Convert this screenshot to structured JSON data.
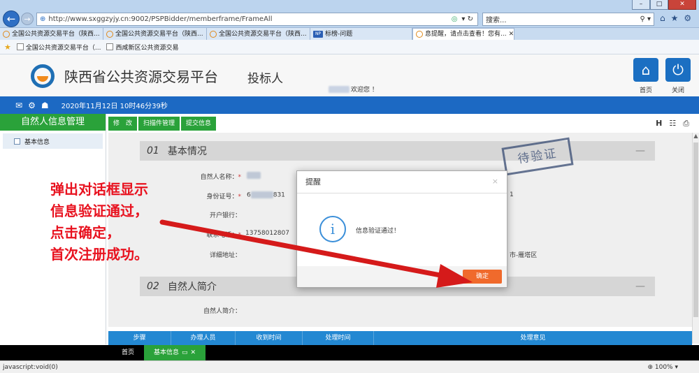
{
  "browser": {
    "url": "http://www.sxggzyjy.cn:9002/PSPBidder/memberframe/FrameAll",
    "search_placeholder": "搜索...",
    "window_controls": [
      "–",
      "□",
      "✕"
    ],
    "tabs": [
      {
        "label": "全国公共资源交易平台（陕西...",
        "active": false
      },
      {
        "label": "全国公共资源交易平台（陕西...",
        "active": false
      },
      {
        "label": "全国公共资源交易平台（陕西...",
        "active": false
      },
      {
        "label": "标榜-问题",
        "active": false
      },
      {
        "label": "息提醒，请点击查看！您有...",
        "active": true
      }
    ],
    "favorites": [
      "全国公共资源交易平台（...",
      "西咸新区公共资源交易"
    ],
    "status_text": "javascript:void(0)",
    "zoom": "100%"
  },
  "header": {
    "site_title": "陕西省公共资源交易平台",
    "role": "投标人",
    "welcome": "欢迎您 ！",
    "home_label": "首页",
    "close_label": "关闭",
    "datetime": "2020年11月12日 10时46分39秒"
  },
  "left_panel": {
    "title": "自然人信息管理",
    "items": [
      "基本信息"
    ]
  },
  "toolbar": {
    "buttons": [
      "修　改",
      "扫描件管理",
      "提交信息"
    ]
  },
  "form": {
    "section1": {
      "num": "01",
      "title": "基本情况"
    },
    "section2": {
      "num": "02",
      "title": "自然人简介"
    },
    "stamp": "待验证",
    "fields": {
      "name_label": "自然人名称：",
      "id_label": "身份证号：",
      "id_value": "6",
      "id_value_mid": "831",
      "id_value_end": "1",
      "bank_label": "开户银行：",
      "contact_label": "联系电话：",
      "contact_value": "13758012807",
      "address_label": "详细地址：",
      "address_value": "市-雁塔区",
      "intro_label": "自然人简介："
    }
  },
  "grid": {
    "columns": [
      "步骤",
      "办理人员",
      "收到时间",
      "处理时间",
      "处理意见"
    ]
  },
  "page_tabs": {
    "home": "首页",
    "active": "基本信息"
  },
  "dialog": {
    "title": "提醒",
    "close": "×",
    "message": "信息验证通过！",
    "ok": "确定"
  },
  "annotation": {
    "lines": [
      "弹出对话框显示",
      "信息验证通过，",
      "点击确定，",
      "首次注册成功。"
    ],
    "color": "#e8121f"
  }
}
